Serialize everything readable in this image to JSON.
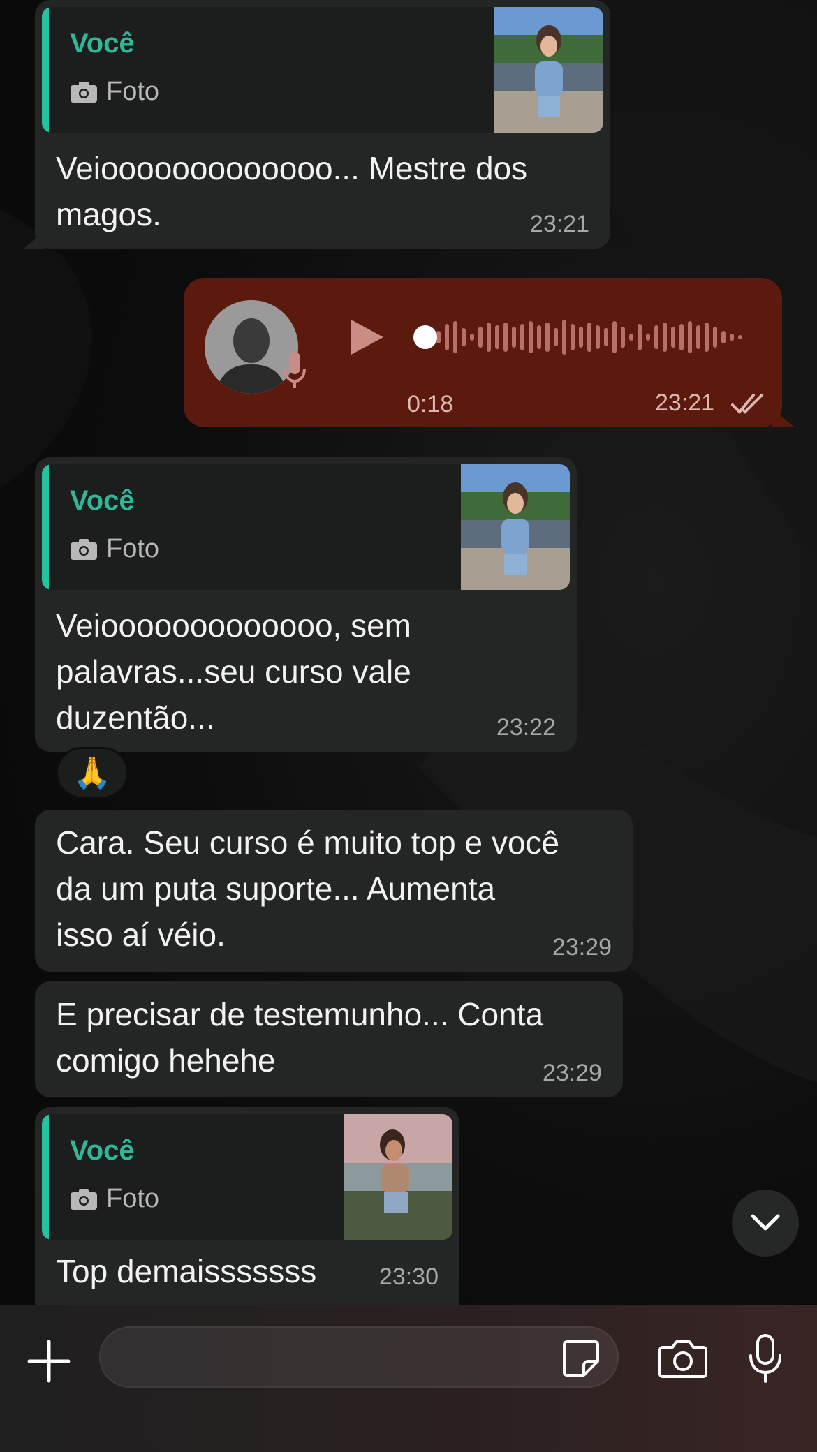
{
  "messages": [
    {
      "quote_author": "Você",
      "quote_type": "Foto",
      "text_lines": [
        "Veiooooooooooooo... Mestre dos",
        "magos."
      ],
      "time": "23:21"
    },
    {
      "voice": {
        "duration": "0:18",
        "time": "23:21",
        "status": "read"
      }
    },
    {
      "quote_author": "Você",
      "quote_type": "Foto",
      "text_lines": [
        "Veiooooooooooooo, sem",
        "palavras...seu curso vale",
        "duzentão..."
      ],
      "time": "23:22",
      "reaction": "🙏"
    },
    {
      "text_lines": [
        "Cara. Seu curso é muito top e você",
        "da um puta suporte... Aumenta",
        "isso aí véio."
      ],
      "time": "23:29"
    },
    {
      "text_lines": [
        "E precisar de testemunho... Conta",
        "comigo hehehe"
      ],
      "time": "23:29"
    },
    {
      "quote_author": "Você",
      "quote_type": "Foto",
      "text_lines": [
        "Top demaisssssss"
      ],
      "time": "23:30"
    }
  ],
  "icons": {
    "camera_small": "camera-icon",
    "play": "play-icon",
    "mic_badge": "microphone-icon",
    "read_ticks": "double-check-icon",
    "scroll_down": "chevron-down-icon",
    "add": "plus-icon",
    "sticker": "sticker-icon",
    "camera": "camera-icon",
    "mic": "microphone-icon"
  },
  "colors": {
    "incoming_bubble": "#242626",
    "outgoing_bubble": "#5c1a0e",
    "quote_accent": "#25c2a0",
    "quote_author": "#30b79a"
  }
}
